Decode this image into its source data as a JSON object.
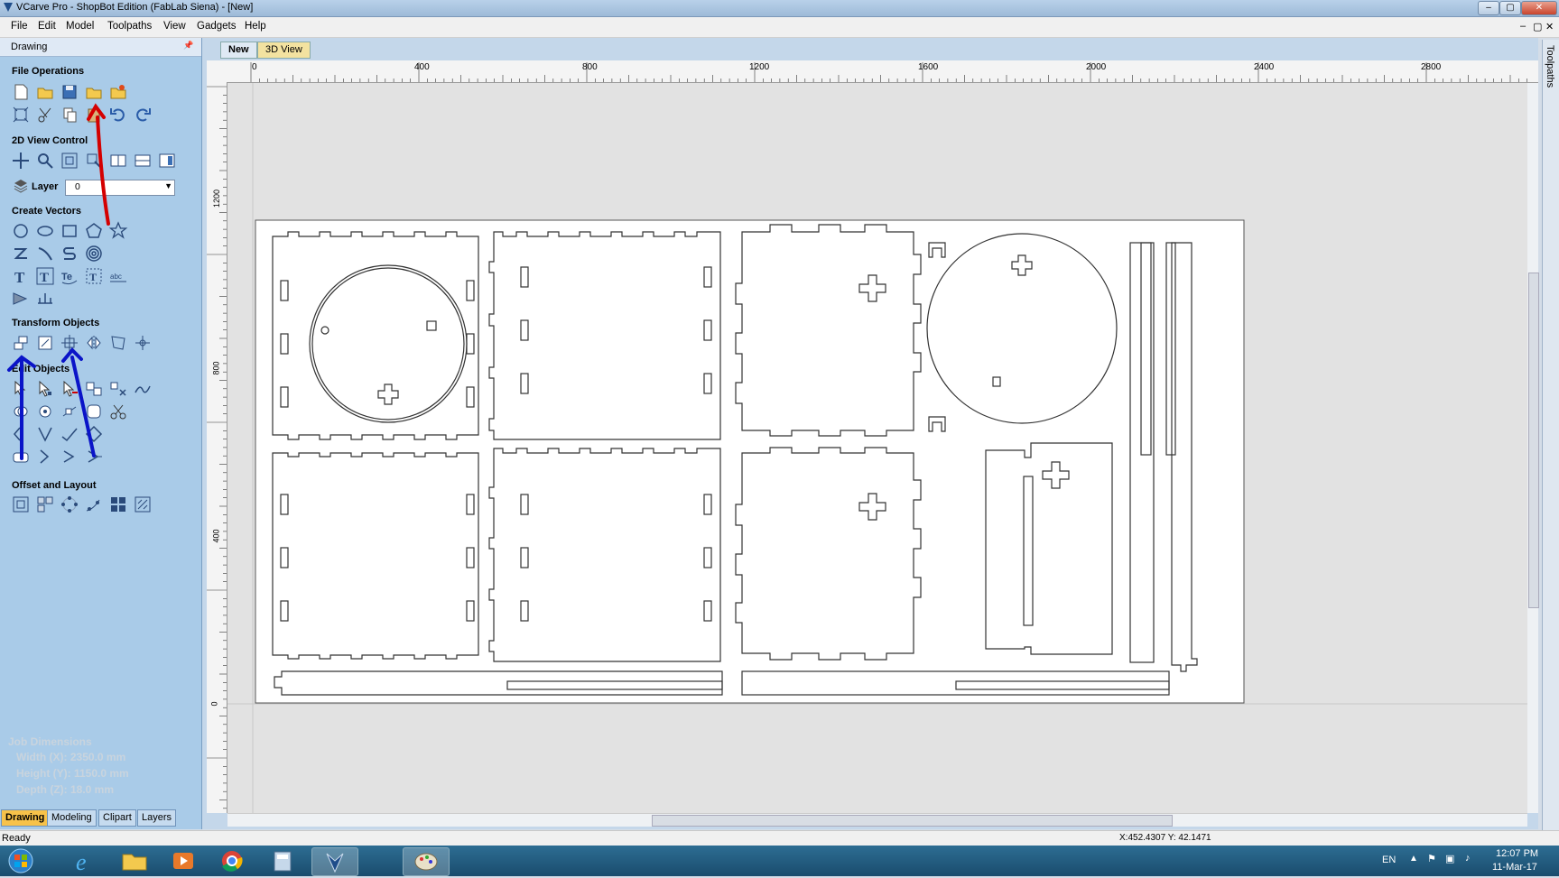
{
  "window": {
    "title": "VCarve Pro - ShopBot Edition (FabLab Siena) - [New]",
    "minimize": "–",
    "maximize": "▢",
    "close": "✕"
  },
  "menu": [
    "File",
    "Edit",
    "Model",
    "Toolpaths",
    "View",
    "Gadgets",
    "Help"
  ],
  "mdi_controls": [
    "–",
    "▢",
    "✕"
  ],
  "panel": {
    "title": "Drawing",
    "pin": "📌",
    "sections": {
      "file_operations": "File Operations",
      "view_control": "2D View Control",
      "create_vectors": "Create Vectors",
      "transform_objects": "Transform Objects",
      "edit_objects": "Edit Objects",
      "offset_layout": "Offset and Layout"
    },
    "layer_label": "Layer",
    "layer_value": "0",
    "job": {
      "heading": "Job Dimensions",
      "width": "Width  (X): 2350.0 mm",
      "height": "Height (Y): 1150.0 mm",
      "depth": "Depth  (Z): 18.0 mm"
    },
    "tabs": [
      "Drawing",
      "Modeling",
      "Clipart",
      "Layers"
    ]
  },
  "doc_tabs": [
    "New",
    "3D View"
  ],
  "right_tab": "Toolpaths",
  "ruler": {
    "top": [
      "0",
      "400",
      "800",
      "1200",
      "1600",
      "2000",
      "2400",
      "2800"
    ],
    "left": [
      "1200",
      "800",
      "400",
      "0"
    ]
  },
  "status": {
    "left": "Ready",
    "coords": "X:452.4307 Y: 42.1471"
  },
  "taskbar": {
    "lang": "EN",
    "time": "12:07 PM",
    "date": "11-Mar-17"
  },
  "colors": {
    "panel": "#a9cbe8",
    "red_annotation": "#d40000",
    "blue_annotation": "#0a14c8"
  }
}
